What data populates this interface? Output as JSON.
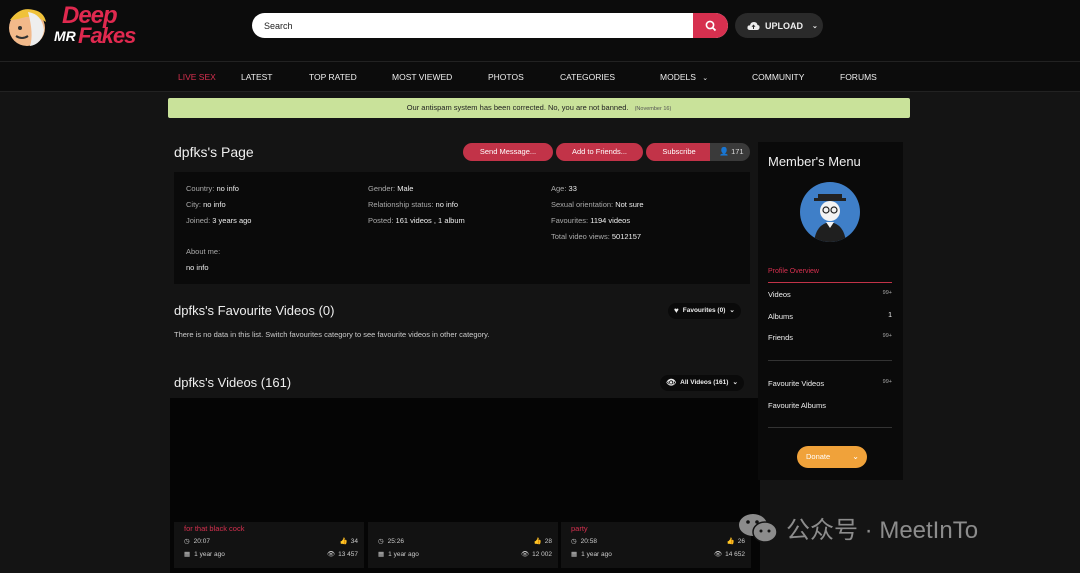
{
  "header": {
    "logo": {
      "line1": "Deep",
      "line2a": "MR",
      "line2b": "Fakes"
    },
    "search_placeholder": "Search",
    "upload_label": "UPLOAD"
  },
  "nav": [
    {
      "label": "LIVE SEX",
      "active": true
    },
    {
      "label": "LATEST"
    },
    {
      "label": "TOP RATED"
    },
    {
      "label": "MOST VIEWED"
    },
    {
      "label": "PHOTOS"
    },
    {
      "label": "CATEGORIES"
    },
    {
      "label": "MODELS"
    },
    {
      "label": "COMMUNITY"
    },
    {
      "label": "FORUMS"
    }
  ],
  "notice": {
    "text": "Our antispam system has been corrected. No, you are not banned.",
    "date": "(November 16)"
  },
  "profile": {
    "title": "dpfks's Page",
    "send_message": "Send Message...",
    "add_friends": "Add to Friends...",
    "subscribe": "Subscribe",
    "subscribers": "171",
    "fields": {
      "country": {
        "label": "Country:",
        "value": "no info"
      },
      "city": {
        "label": "City:",
        "value": "no info"
      },
      "joined": {
        "label": "Joined:",
        "value": "3 years ago"
      },
      "gender": {
        "label": "Gender:",
        "value": "Male"
      },
      "relationship": {
        "label": "Relationship status:",
        "value": "no info"
      },
      "posted": {
        "label": "Posted:",
        "value": "161 videos , 1 album"
      },
      "age": {
        "label": "Age:",
        "value": "33"
      },
      "orientation": {
        "label": "Sexual orientation:",
        "value": "Not sure"
      },
      "favourites": {
        "label": "Favourites:",
        "value": "1194 videos"
      },
      "total_views": {
        "label": "Total video views:",
        "value": "5012157"
      },
      "about": {
        "label": "About me:",
        "value": "no info"
      }
    }
  },
  "favourites": {
    "title": "dpfks's Favourite Videos (0)",
    "select": "Favourites (0)",
    "empty": "There is no data in this list. Switch favourites category to see favourite videos in other category."
  },
  "videos": {
    "title": "dpfks's Videos (161)",
    "select": "All Videos (161)",
    "items": [
      {
        "title": "for that black cock",
        "duration": "20:07",
        "likes": "34",
        "age": "1 year ago",
        "views": "13 457"
      },
      {
        "title": "",
        "duration": "25:26",
        "likes": "28",
        "age": "1 year ago",
        "views": "12 002"
      },
      {
        "title": "party",
        "duration": "20:58",
        "likes": "26",
        "age": "1 year ago",
        "views": "14 652"
      }
    ]
  },
  "sidebar": {
    "title": "Member's Menu",
    "subtitle": "Profile Overview",
    "items": [
      {
        "label": "Videos",
        "count": "99+"
      },
      {
        "label": "Albums",
        "count": "1"
      },
      {
        "label": "Friends",
        "count": "99+"
      },
      {
        "label": "Favourite Videos",
        "count": "99+"
      },
      {
        "label": "Favourite Albums",
        "count": ""
      }
    ],
    "donate": "Donate"
  },
  "watermark": "公众号 · MeetInTo",
  "colors": {
    "accent": "#d6304f",
    "notice": "#c9e29a",
    "donate": "#f0a23a"
  }
}
